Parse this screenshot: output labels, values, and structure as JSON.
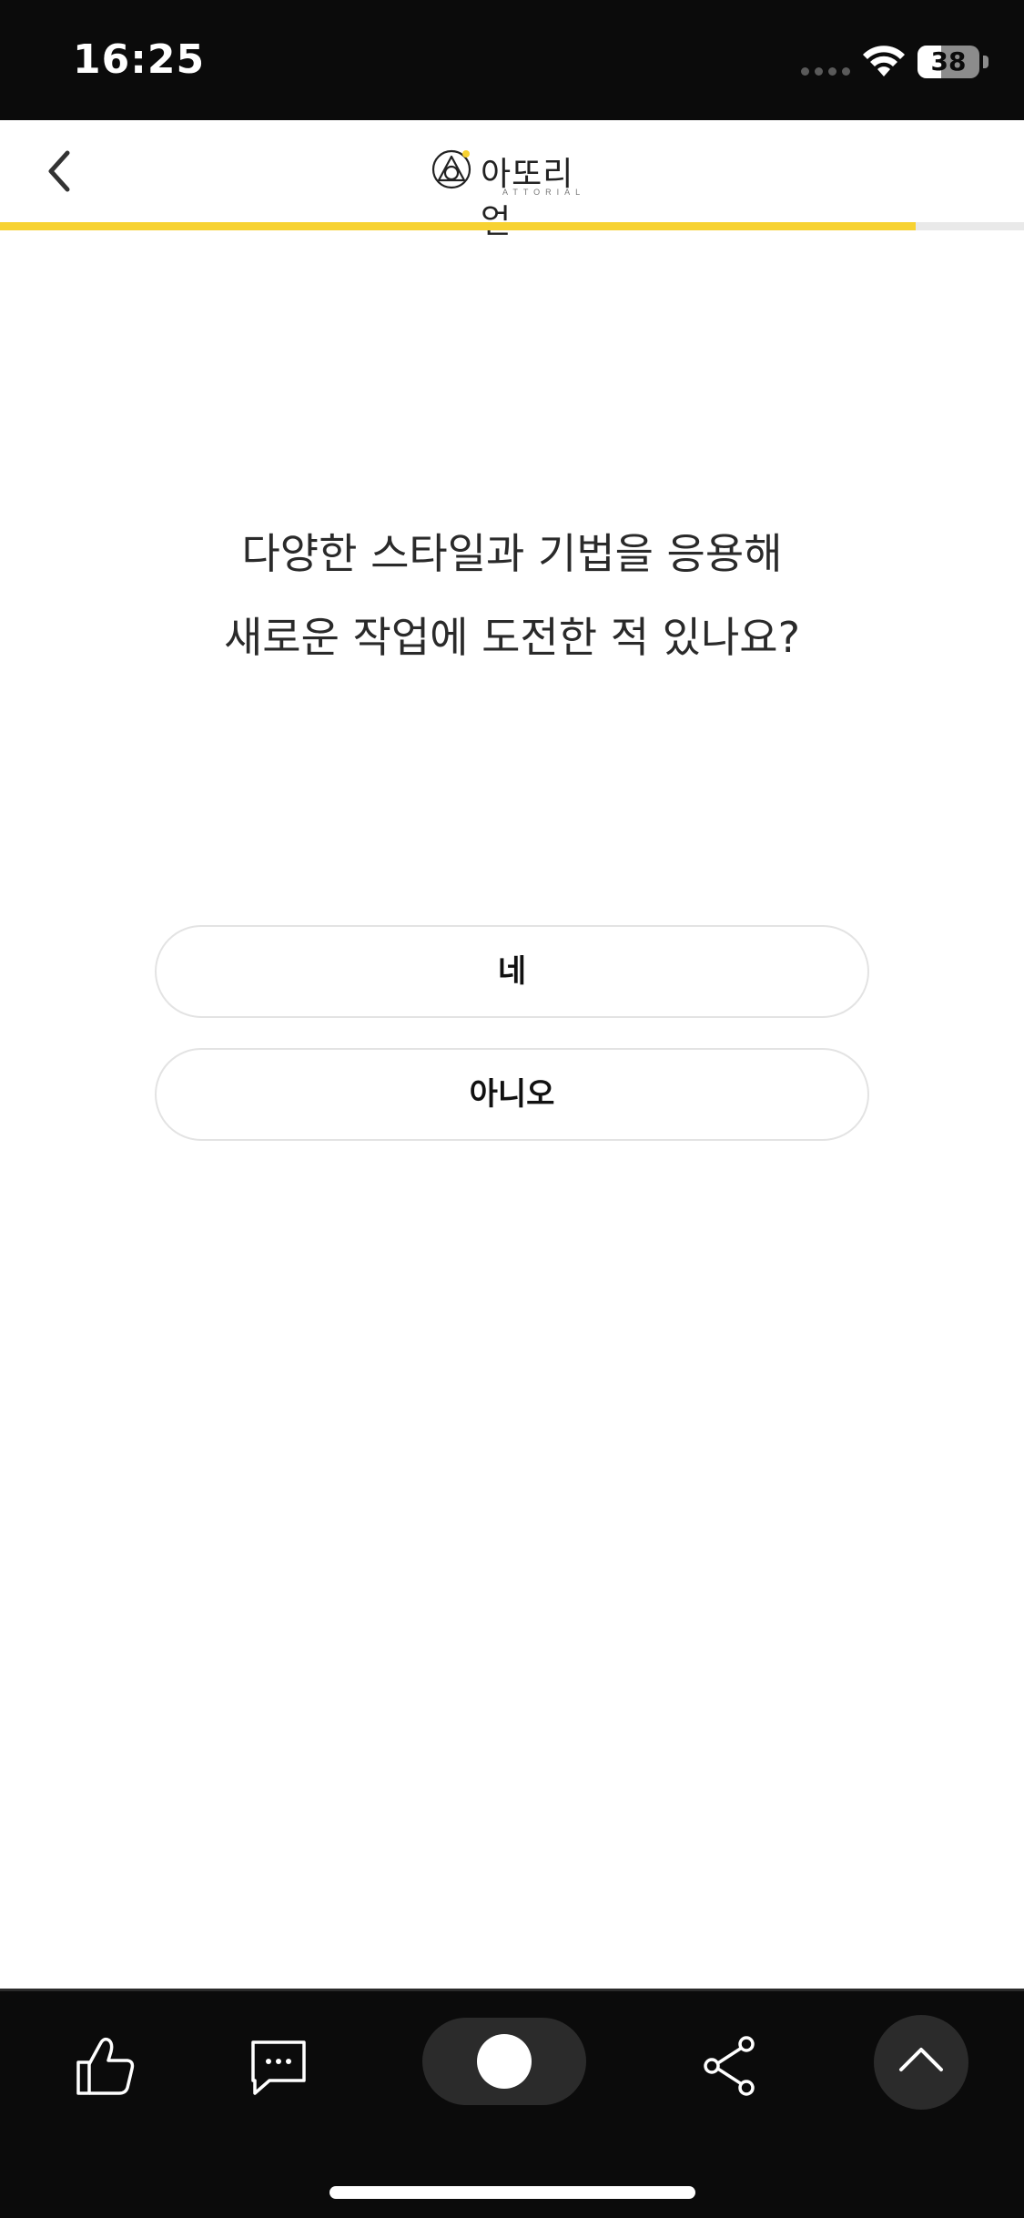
{
  "status_bar": {
    "time": "16:25",
    "battery_level": "38",
    "battery_fraction": 0.38
  },
  "header": {
    "logo_text": "아또리얼",
    "logo_subtext": "ATTORIAL",
    "back_icon": "chevron-left-icon",
    "progress_fraction": 0.894,
    "progress_color": "#f7d232"
  },
  "question": {
    "line1": "다양한 스타일과 기법을 응용해",
    "line2": "새로운 작업에 도전한 적 있나요?"
  },
  "answers": [
    {
      "label": "네"
    },
    {
      "label": "아니오"
    }
  ],
  "toolbar": {
    "icons": [
      "thumbs-up-icon",
      "comment-icon",
      "toggle-icon",
      "share-icon",
      "chevron-up-icon"
    ]
  }
}
